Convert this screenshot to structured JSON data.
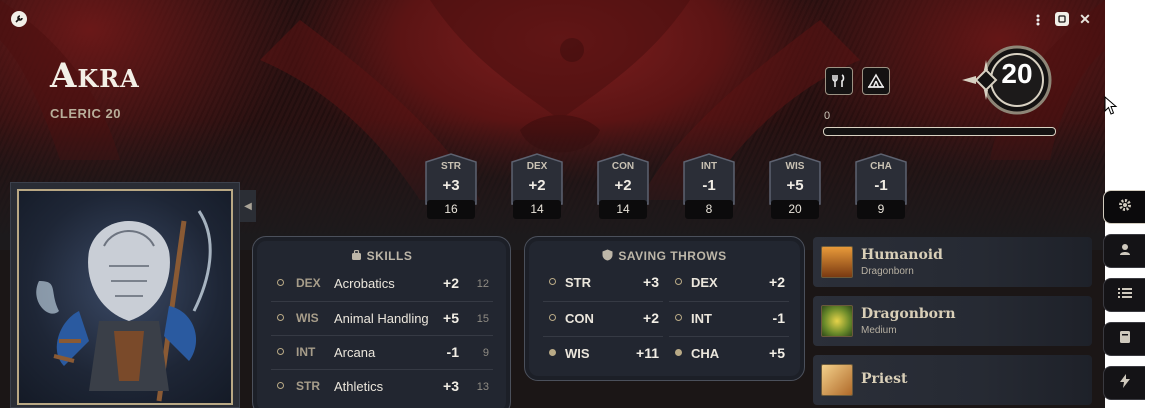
{
  "window": {
    "app_icon": "wrench-icon",
    "menu_icon": "vertical-ellipsis-icon",
    "token_icon": "token-icon",
    "close_icon": "close-icon"
  },
  "character": {
    "name": "Akra",
    "class_line": "CLERIC 20",
    "level": "20",
    "xp_value": "0",
    "xp_progress": 0
  },
  "rest_buttons": [
    {
      "name": "short-rest",
      "icon": "utensils-icon"
    },
    {
      "name": "long-rest",
      "icon": "tent-icon"
    }
  ],
  "abilities": [
    {
      "label": "STR",
      "mod": "+3",
      "score": "16"
    },
    {
      "label": "DEX",
      "mod": "+2",
      "score": "14"
    },
    {
      "label": "CON",
      "mod": "+2",
      "score": "14"
    },
    {
      "label": "INT",
      "mod": "-1",
      "score": "8"
    },
    {
      "label": "WIS",
      "mod": "+5",
      "score": "20"
    },
    {
      "label": "CHA",
      "mod": "-1",
      "score": "9"
    }
  ],
  "skills": {
    "title": "SKILLS",
    "icon": "backpack-icon",
    "rows": [
      {
        "ability": "DEX",
        "name": "Acrobatics",
        "mod": "+2",
        "passive": "12",
        "proficient": false
      },
      {
        "ability": "WIS",
        "name": "Animal Handling",
        "mod": "+5",
        "passive": "15",
        "proficient": false
      },
      {
        "ability": "INT",
        "name": "Arcana",
        "mod": "-1",
        "passive": "9",
        "proficient": false
      },
      {
        "ability": "STR",
        "name": "Athletics",
        "mod": "+3",
        "passive": "13",
        "proficient": false
      }
    ]
  },
  "saving_throws": {
    "title": "SAVING THROWS",
    "icon": "shield-icon",
    "rows": [
      [
        {
          "ability": "STR",
          "mod": "+3",
          "proficient": false
        },
        {
          "ability": "DEX",
          "mod": "+2",
          "proficient": false
        }
      ],
      [
        {
          "ability": "CON",
          "mod": "+2",
          "proficient": false
        },
        {
          "ability": "INT",
          "mod": "-1",
          "proficient": false
        }
      ],
      [
        {
          "ability": "WIS",
          "mod": "+11",
          "proficient": true
        },
        {
          "ability": "CHA",
          "mod": "+5",
          "proficient": true
        }
      ]
    ]
  },
  "features": [
    {
      "title": "Humanoid",
      "subtitle": "Dragonborn",
      "icon": "humanoid-figures-icon"
    },
    {
      "title": "Dragonborn",
      "subtitle": "Medium",
      "icon": "dragon-eye-icon"
    },
    {
      "title": "Priest",
      "subtitle": "",
      "icon": "priest-icon"
    }
  ],
  "side_tabs": [
    {
      "name": "settings",
      "icon": "gear-icon",
      "active": true
    },
    {
      "name": "npc",
      "icon": "character-icon",
      "active": false
    },
    {
      "name": "list",
      "icon": "list-icon",
      "active": false
    },
    {
      "name": "journal",
      "icon": "book-icon",
      "active": false
    },
    {
      "name": "actions",
      "icon": "bolt-icon",
      "active": false
    }
  ],
  "colors": {
    "banner_red": "#7e1f1f",
    "panel_bg": "#222630",
    "accent_gold": "#b9aa86"
  }
}
